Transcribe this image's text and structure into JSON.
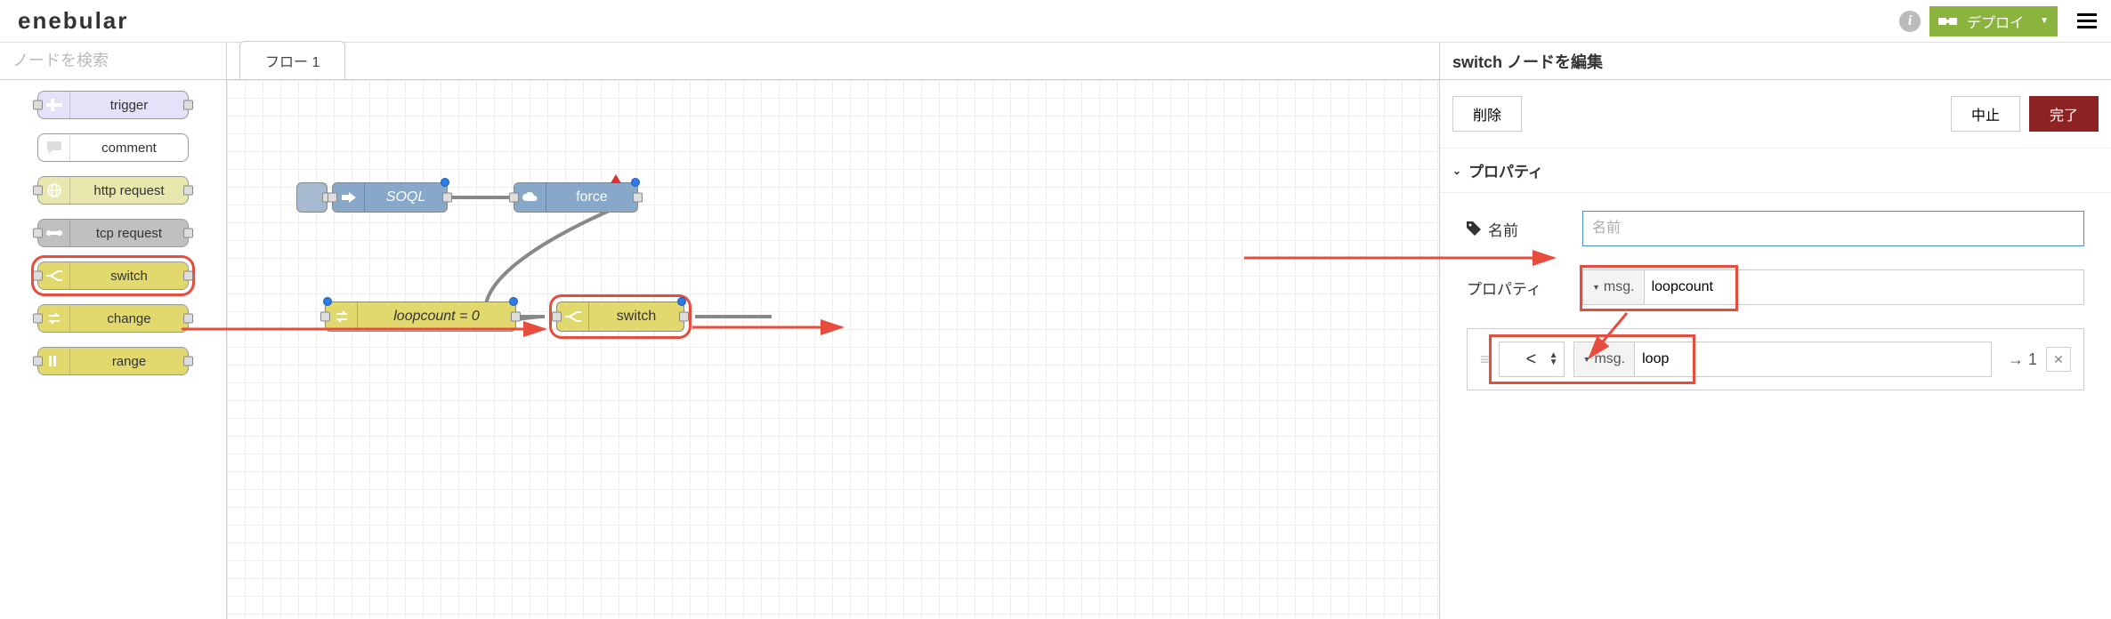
{
  "header": {
    "logo": "enebular",
    "deploy_label": "デプロイ"
  },
  "search": {
    "placeholder": "ノードを検索"
  },
  "palette": {
    "trigger": "trigger",
    "comment": "comment",
    "http": "http request",
    "tcp": "tcp request",
    "switch": "switch",
    "change": "change",
    "range": "range"
  },
  "canvas": {
    "tab": "フロー 1",
    "soql": "SOQL",
    "force": "force",
    "loopcount": "loopcount = 0",
    "switch": "switch"
  },
  "edit": {
    "title": "switch ノードを編集",
    "delete": "削除",
    "cancel": "中止",
    "done": "完了",
    "section": "プロパティ",
    "name_label": "名前",
    "name_placeholder": "名前",
    "property_label": "プロパティ",
    "msg_prefix": "msg.",
    "property_value": "loopcount",
    "rule_op": "<",
    "rule_value": "loop",
    "rule_output": "→ 1"
  }
}
